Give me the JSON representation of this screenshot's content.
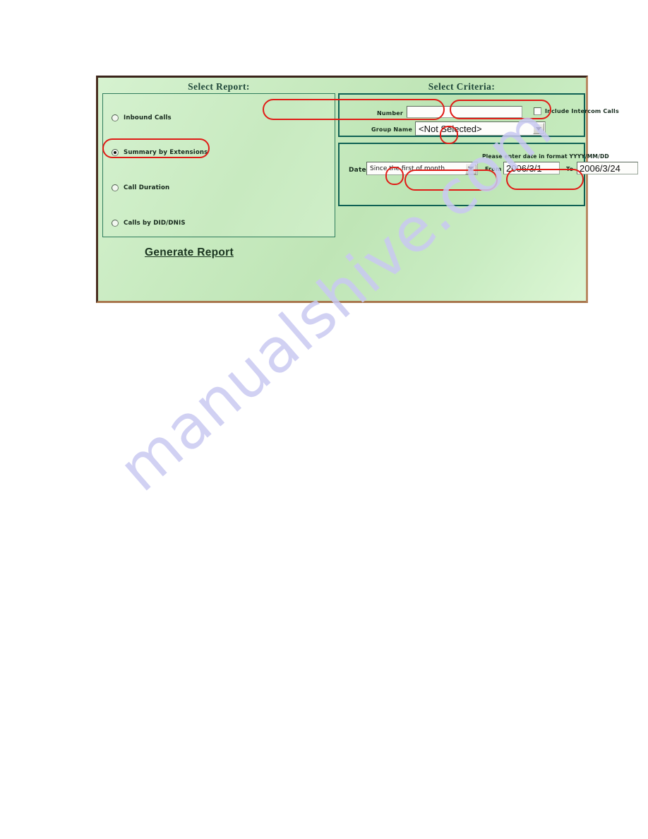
{
  "watermark": {
    "text": "manualshive.com"
  },
  "headings": {
    "select_report": "Select Report:",
    "select_criteria": "Select Criteria:"
  },
  "report_panel": {
    "options": [
      {
        "label": "Inbound Calls",
        "selected": false
      },
      {
        "label": "Summary by Extensions",
        "selected": true
      },
      {
        "label": "Call Duration",
        "selected": false
      },
      {
        "label": "Calls by DID/DNIS",
        "selected": false
      }
    ],
    "generate_label": "Generate Report"
  },
  "criteria": {
    "number_label": "Number",
    "number_value": "",
    "number_placeholder": "",
    "intercom_label": "Include Intercom Calls",
    "intercom_checked": false,
    "group_label": "Group Name",
    "group_value": "<Not Selected>",
    "group_options": [
      "<Not Selected>"
    ]
  },
  "date_criteria": {
    "date_label": "Date",
    "date_value": "Since the first of month",
    "date_options": [
      "Since the first of month"
    ],
    "hint": "Please enter date in format YYYY/MM/DD",
    "from_label": "From",
    "from_value": "2006/3/1",
    "to_label": "To",
    "to_value": "2006/3/24"
  },
  "colors": {
    "panel_border": "#3a241a",
    "section_border": "#0f6154",
    "report_border": "#2f7c5c",
    "annotation": "#e01b16",
    "panel_bg_light": "#d8f3d2",
    "panel_bg_dark": "#bfe4b7",
    "heading_text": "#20483a",
    "watermark": "#c9c9f2"
  }
}
